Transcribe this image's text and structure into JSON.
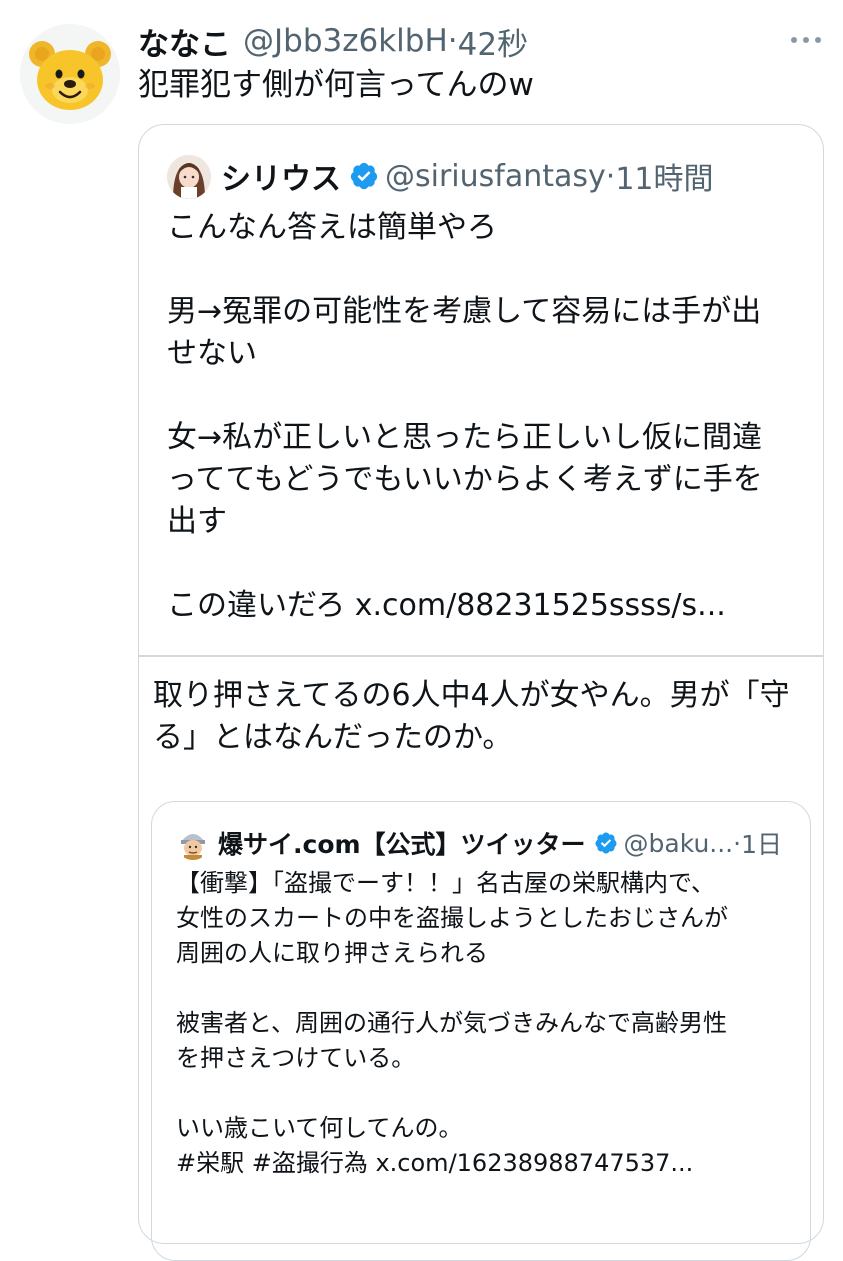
{
  "tweet": {
    "display_name": "ななこ",
    "handle": "@Jbb3z6klbH",
    "separator": "·",
    "time": "42秒",
    "avatar_icon": "bear-face-icon",
    "more_icon": "more-dots-icon",
    "text": "犯罪犯す側が何言ってんのw"
  },
  "quote": {
    "display_name": "シリウス",
    "handle": "@siriusfantasy",
    "separator": "·",
    "time": "11時間",
    "verified_icon": "verified-badge-icon",
    "lines": [
      "こんなん答えは簡単やろ",
      "男→冤罪の可能性を考慮して容易には手が出",
      "せない",
      "女→私が正しいと思ったら正しいし仮に間違",
      "っててもどうでもいいからよく考えずに手を",
      "出す",
      "この違いだろ x.com/88231525ssss/s..."
    ],
    "reply_lines": [
      "取り押さえてるの6人中4人が女やん。男が「守",
      "る」とはなんだったのか。"
    ]
  },
  "inner_quote": {
    "display_name": "爆サイ.com【公式】ツイッター",
    "handle": "@baku...",
    "separator": "·",
    "time": "1日",
    "lines": [
      "【衝撃】「盗撮でーす！！」名古屋の栄駅構内で、",
      "女性のスカートの中を盗撮しようとしたおじさんが",
      "周囲の人に取り押さえられる",
      "被害者と、周囲の通行人が気づきみんなで高齢男性",
      "を押さえつけている。",
      "いい歳こいて何してんの。",
      "#栄駅 #盗撮行為 x.com/16238988747537..."
    ]
  },
  "colors": {
    "verified": "#1d9bf0",
    "muted": "#536471",
    "border": "#cfd9de",
    "pooh_yellow": "#f7c52a"
  }
}
